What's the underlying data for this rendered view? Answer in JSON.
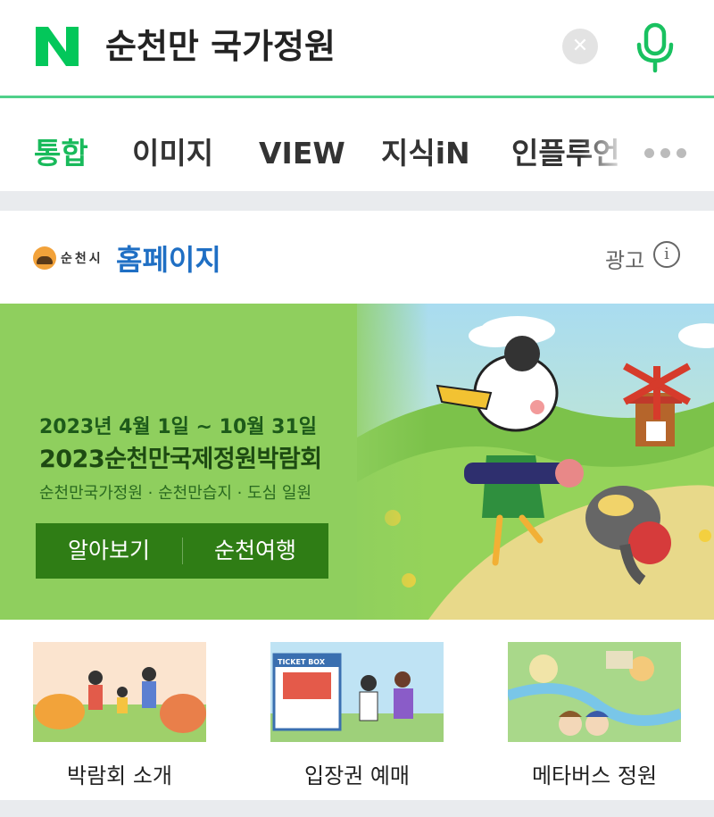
{
  "search": {
    "query": "순천만 국가정원",
    "logo_letter": "N"
  },
  "tabs": [
    {
      "label": "통합",
      "active": true
    },
    {
      "label": "이미지"
    },
    {
      "label": "VIEW"
    },
    {
      "label": "지식iN"
    },
    {
      "label": "인플루언"
    }
  ],
  "ad": {
    "city_name": "순천시",
    "homepage_label": "홈페이지",
    "ad_label": "광고",
    "banner": {
      "date": "2023년 4월 1일 ~ 10월 31일",
      "title": "2023순천만국제정원박람회",
      "venue": "순천만국가정원 · 순천만습지 · 도심 일원",
      "button_left": "알아보기",
      "button_right": "순천여행"
    },
    "thumbnails": [
      {
        "label": "박람회 소개"
      },
      {
        "label": "입장권 예매",
        "sign": "TICKET BOX"
      },
      {
        "label": "메타버스 정원"
      }
    ]
  },
  "colors": {
    "naver_green": "#03c75a",
    "active_tab": "#19ba5b",
    "link_blue": "#1f6fc4",
    "banner_button": "#2f7d15"
  },
  "icons": [
    "naver-logo-icon",
    "clear-icon",
    "microphone-icon",
    "more-dots-icon",
    "suncheon-emblem-icon",
    "info-icon"
  ]
}
